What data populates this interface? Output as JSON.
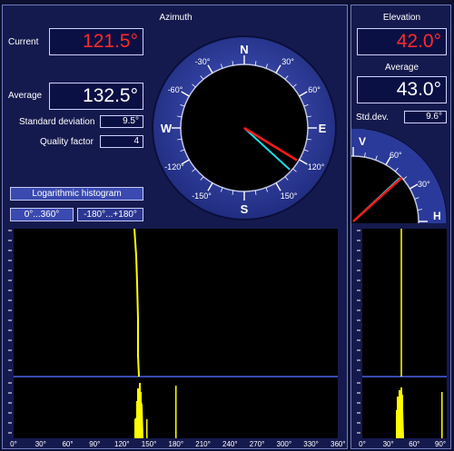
{
  "azimuth": {
    "title": "Azimuth",
    "current_label": "Current",
    "current_value": "121.5°",
    "average_label": "Average",
    "average_value": "132.5°",
    "stddev_label": "Standard deviation",
    "stddev_value": "9.5°",
    "quality_label": "Quality factor",
    "quality_value": "4",
    "compass": {
      "cardinals": [
        "N",
        "E",
        "S",
        "W"
      ],
      "degree_labels": [
        "30°",
        "60°",
        "120°",
        "150°",
        "-30°",
        "-60°",
        "-120°",
        "-150°"
      ],
      "current_deg": 121.5,
      "average_deg": 132.5
    },
    "log_hist_button": "Logarithmic histogram",
    "range_button_1": "0°...360°",
    "range_button_2": "-180°...+180°",
    "x_ticks": [
      "0°",
      "30°",
      "60°",
      "90°",
      "120°",
      "150°",
      "180°",
      "210°",
      "240°",
      "270°",
      "300°",
      "330°",
      "360°"
    ]
  },
  "elevation": {
    "title": "Elevation",
    "current_value": "42.0°",
    "average_label": "Average",
    "average_value": "43.0°",
    "stddev_label": "Std.dev.",
    "stddev_value": "9.6°",
    "gauge": {
      "v_label": "V",
      "h_label": "H",
      "label_60": "60°",
      "label_30": "30°",
      "current_deg": 42.0,
      "average_deg": 43.0
    },
    "x_ticks": [
      "0°",
      "30°",
      "60°",
      "90°"
    ]
  },
  "colors": {
    "current_needle": "#ff1a1a",
    "average_needle": "#1ee0e8",
    "histogram": "#ffff00",
    "dial_ring": "#2a3a9a"
  }
}
